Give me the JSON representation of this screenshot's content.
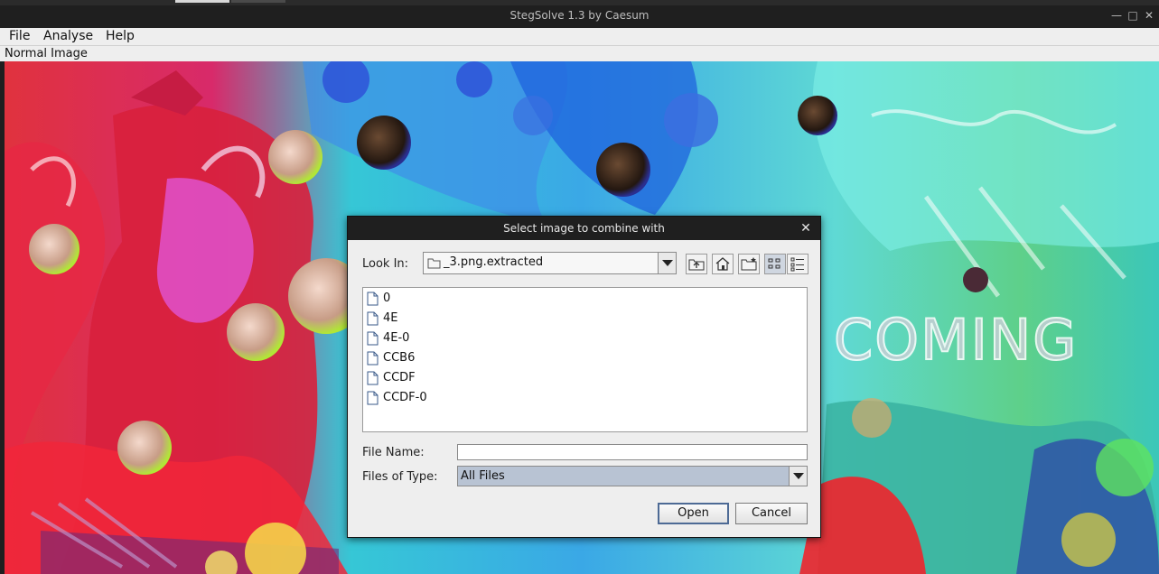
{
  "window": {
    "title": "StegSolve 1.3 by Caesum"
  },
  "menu": {
    "items": [
      "File",
      "Analyse",
      "Help"
    ]
  },
  "image_panel": {
    "title": "Normal Image",
    "overlay_text": "COMING"
  },
  "dialog": {
    "title": "Select image to combine with",
    "look_in_label": "Look In:",
    "look_in_value": "_3.png.extracted",
    "files": [
      "0",
      "4E",
      "4E-0",
      "CCB6",
      "CCDF",
      "CCDF-0"
    ],
    "file_name_label": "File Name:",
    "file_name_value": "",
    "files_of_type_label": "Files of Type:",
    "files_of_type_value": "All Files",
    "open_label": "Open",
    "cancel_label": "Cancel"
  },
  "colors": {
    "titlebar": "#1f1f1f",
    "selection": "#b8c3d3",
    "button_focus": "#4d6a95"
  }
}
